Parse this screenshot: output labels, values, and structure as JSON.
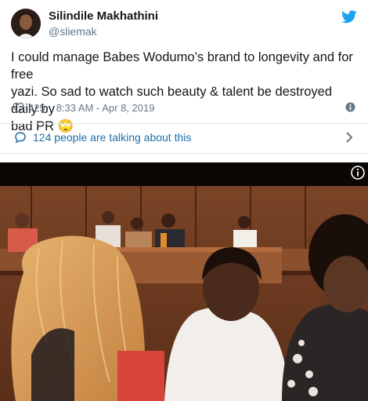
{
  "tweet": {
    "author_name": "Silindile Makhathini",
    "author_handle": "@sliemak",
    "text": "I could manage Babes Wodumo’s brand to longevity and for free\nyazi. So sad to watch such beauty & talent be destroyed daily by\nbad PR 🙄",
    "likes": "425",
    "timestamp": "8:33 AM - Apr 8, 2019",
    "talking_label": "124 people are talking about this"
  },
  "icons": {
    "avatar": "avatar-photo",
    "brand": "twitter-bird-icon",
    "like": "heart-icon",
    "info": "info-icon",
    "conversation": "speech-bubble-icon",
    "more": "chevron-right-icon",
    "video_info": "info-icon"
  },
  "colors": {
    "text": "#14171a",
    "secondary": "#657786",
    "twitter_blue": "#1da1f2",
    "link_blue": "#1b6fa8",
    "divider": "#e1e8ed"
  },
  "video": {
    "scene": "courtroom photo"
  }
}
